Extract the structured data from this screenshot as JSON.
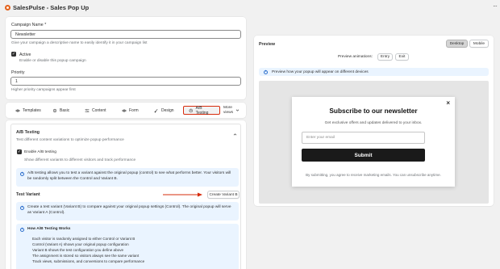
{
  "app": {
    "title": "SalesPulse - Sales Pop Up",
    "menu_icon": "kebab-icon"
  },
  "form": {
    "campaign_name_label": "Campaign Name *",
    "campaign_name_value": "Newsletter",
    "campaign_name_help": "Give your campaign a descriptive name to easily identify it in your campaign list",
    "active_label": "Active",
    "active_help": "Enable or disable this popup campaign",
    "priority_label": "Priority",
    "priority_value": "1",
    "priority_help": "Higher priority campaigns appear first"
  },
  "tabs": [
    {
      "label": "Templates",
      "icon": "eye-icon"
    },
    {
      "label": "Basic",
      "icon": "gear-icon"
    },
    {
      "label": "Content",
      "icon": "sliders-icon"
    },
    {
      "label": "Form",
      "icon": "form-icon"
    },
    {
      "label": "Design",
      "icon": "brush-icon"
    },
    {
      "label": "A/B Testing",
      "icon": "ab-test-icon"
    }
  ],
  "more_views": {
    "line1": "More",
    "line2": "views",
    "icon": "chevron-down-icon"
  },
  "ab": {
    "title": "A/B Testing",
    "subtitle": "Test different content variations to optimize popup performance",
    "enable_label": "Enable A/B testing",
    "enable_help": "Show different variants to different visitors and track performance",
    "info": "A/B testing allows you to test a variant against the original popup (control) to see what performs better. Your visitors will be randomly split between the Control and Variant B.",
    "test_variant_title": "Test Variant",
    "create_button": "Create Variant B",
    "variant_info": "Create a test variant (Variant B) to compare against your original popup settings (Control). The original popup will serve as Variant A (Control).",
    "how_title": "How A/B Testing Works",
    "how_items": [
      "Each visitor is randomly assigned to either Control or Variant B",
      "Control (Variant A) shows your original popup configuration",
      "Variant B shows the test configuration you define above",
      "The assignment is stored so visitors always see the same variant",
      "Track views, submissions, and conversions to compare performance"
    ]
  },
  "preview": {
    "title": "Preview",
    "desktop_label": "Desktop",
    "mobile_label": "Mobile",
    "animations_label": "Preview animations:",
    "entry_label": "Entry",
    "exit_label": "Exit",
    "info": "Preview how your popup will appear on different devices",
    "popup": {
      "close": "×",
      "heading": "Subscribe to our newsletter",
      "subtext": "Get exclusive offers and updates delivered to your inbox.",
      "email_placeholder": "Enter your email",
      "submit_label": "Submit",
      "footer": "By submitting, you agree to receive marketing emails. You can unsubscribe anytime."
    }
  },
  "colors": {
    "accent": "#d72c0d",
    "brand": "#e3611c",
    "info_bg": "#eaf4ff",
    "primary_button": "#1a1a1a"
  }
}
